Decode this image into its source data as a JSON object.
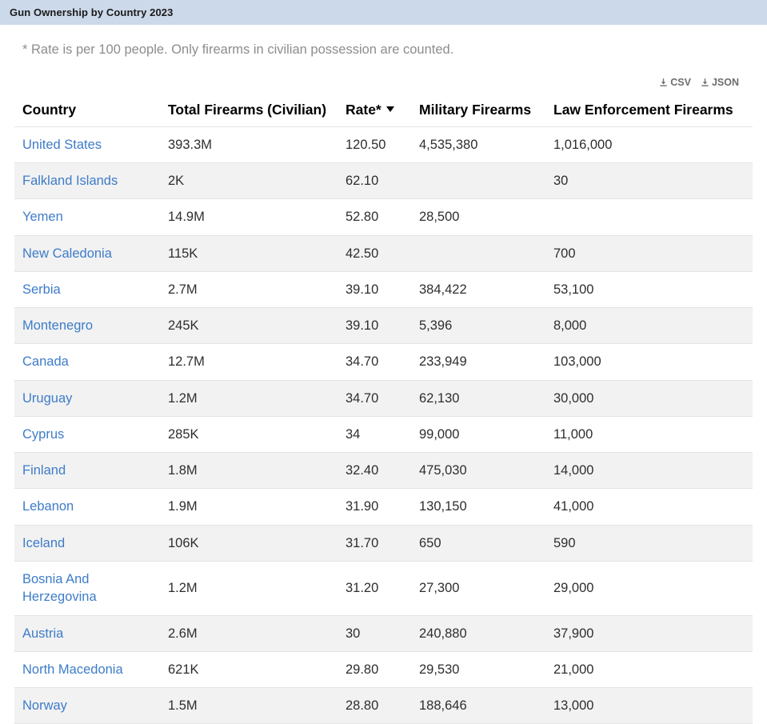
{
  "window": {
    "title": "Gun Ownership by Country 2023"
  },
  "note": "* Rate is per 100 people. Only firearms in civilian possession are counted.",
  "downloads": [
    {
      "label": "CSV",
      "icon": "download-icon"
    },
    {
      "label": "JSON",
      "icon": "download-icon"
    }
  ],
  "colors": {
    "titlebar": "#ccd9ea",
    "link": "#3d7cc9",
    "stripe": "#f2f2f2",
    "note_text": "#8d8d8d"
  },
  "table": {
    "sort": {
      "column": "Rate*",
      "direction": "descending",
      "indicator": "▼"
    },
    "columns": [
      "Country",
      "Total Firearms (Civilian)",
      "Rate*",
      "Military Firearms",
      "Law Enforcement Firearms"
    ],
    "rows": [
      {
        "country": "United States",
        "total": "393.3M",
        "rate": "120.50",
        "military": "4,535,380",
        "law": "1,016,000"
      },
      {
        "country": "Falkland Islands",
        "total": "2K",
        "rate": "62.10",
        "military": "",
        "law": "30"
      },
      {
        "country": "Yemen",
        "total": "14.9M",
        "rate": "52.80",
        "military": "28,500",
        "law": ""
      },
      {
        "country": "New Caledonia",
        "total": "115K",
        "rate": "42.50",
        "military": "",
        "law": "700"
      },
      {
        "country": "Serbia",
        "total": "2.7M",
        "rate": "39.10",
        "military": "384,422",
        "law": "53,100"
      },
      {
        "country": "Montenegro",
        "total": "245K",
        "rate": "39.10",
        "military": "5,396",
        "law": "8,000"
      },
      {
        "country": "Canada",
        "total": "12.7M",
        "rate": "34.70",
        "military": "233,949",
        "law": "103,000"
      },
      {
        "country": "Uruguay",
        "total": "1.2M",
        "rate": "34.70",
        "military": "62,130",
        "law": "30,000"
      },
      {
        "country": "Cyprus",
        "total": "285K",
        "rate": "34",
        "military": "99,000",
        "law": "11,000"
      },
      {
        "country": "Finland",
        "total": "1.8M",
        "rate": "32.40",
        "military": "475,030",
        "law": "14,000"
      },
      {
        "country": "Lebanon",
        "total": "1.9M",
        "rate": "31.90",
        "military": "130,150",
        "law": "41,000"
      },
      {
        "country": "Iceland",
        "total": "106K",
        "rate": "31.70",
        "military": "650",
        "law": "590"
      },
      {
        "country": "Bosnia And Herzegovina",
        "total": "1.2M",
        "rate": "31.20",
        "military": "27,300",
        "law": "29,000"
      },
      {
        "country": "Austria",
        "total": "2.6M",
        "rate": "30",
        "military": "240,880",
        "law": "37,900"
      },
      {
        "country": "North Macedonia",
        "total": "621K",
        "rate": "29.80",
        "military": "29,530",
        "law": "21,000"
      },
      {
        "country": "Norway",
        "total": "1.5M",
        "rate": "28.80",
        "military": "188,646",
        "law": "13,000"
      }
    ]
  }
}
